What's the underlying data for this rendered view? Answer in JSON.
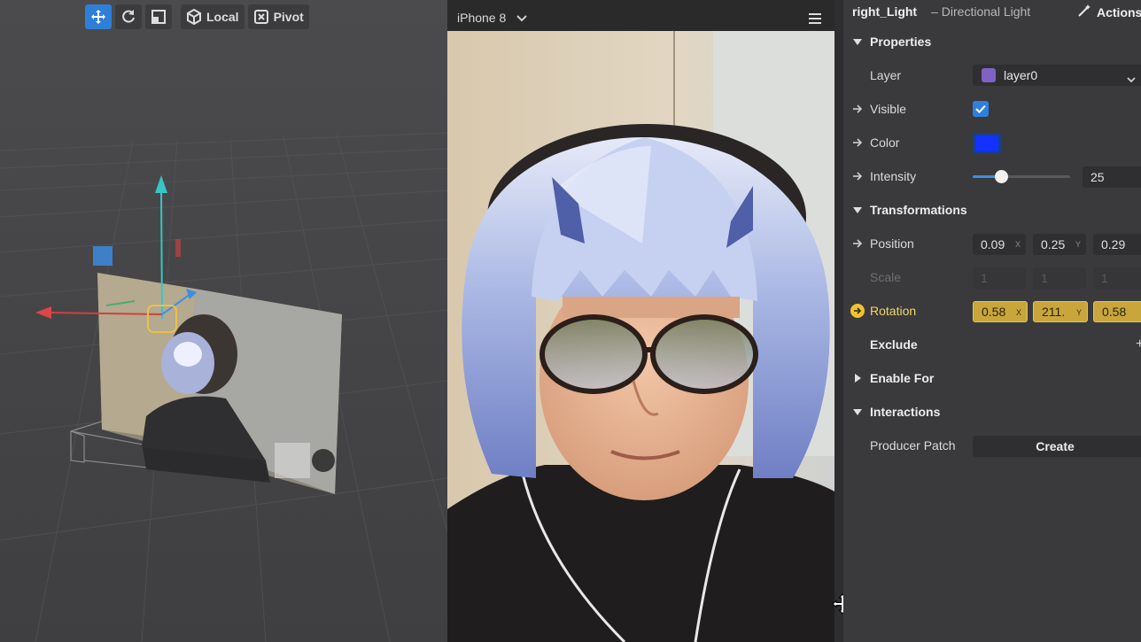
{
  "toolbar": {
    "local_label": "Local",
    "pivot_label": "Pivot"
  },
  "simulator": {
    "device": "iPhone 8"
  },
  "inspector": {
    "title": "right_Light",
    "type": "– Directional Light",
    "actions_label": "Actions",
    "sections": {
      "properties": "Properties",
      "transformations": "Transformations",
      "exclude": "Exclude",
      "enable_for": "Enable For",
      "interactions": "Interactions"
    },
    "layer": {
      "label": "Layer",
      "value": "layer0",
      "swatch_color": "#7f63c4"
    },
    "visible": {
      "label": "Visible",
      "checked": true
    },
    "color": {
      "label": "Color",
      "value": "#1432ff"
    },
    "intensity": {
      "label": "Intensity",
      "value": "25",
      "slider_fraction": 0.29
    },
    "position": {
      "label": "Position",
      "x": "0.09",
      "y": "0.25",
      "z": "0.29",
      "x_axis": "X",
      "y_axis": "Y"
    },
    "scale": {
      "label": "Scale",
      "x": "1",
      "y": "1",
      "z": "1"
    },
    "rotation": {
      "label": "Rotation",
      "x": "0.58",
      "y": "211.",
      "z": "0.58",
      "x_axis": "X",
      "y_axis": "Y"
    },
    "producer_patch": {
      "label": "Producer Patch",
      "button": "Create"
    }
  },
  "colors": {
    "accent": "#2d7fd8",
    "keyframe": "#f0c232"
  }
}
